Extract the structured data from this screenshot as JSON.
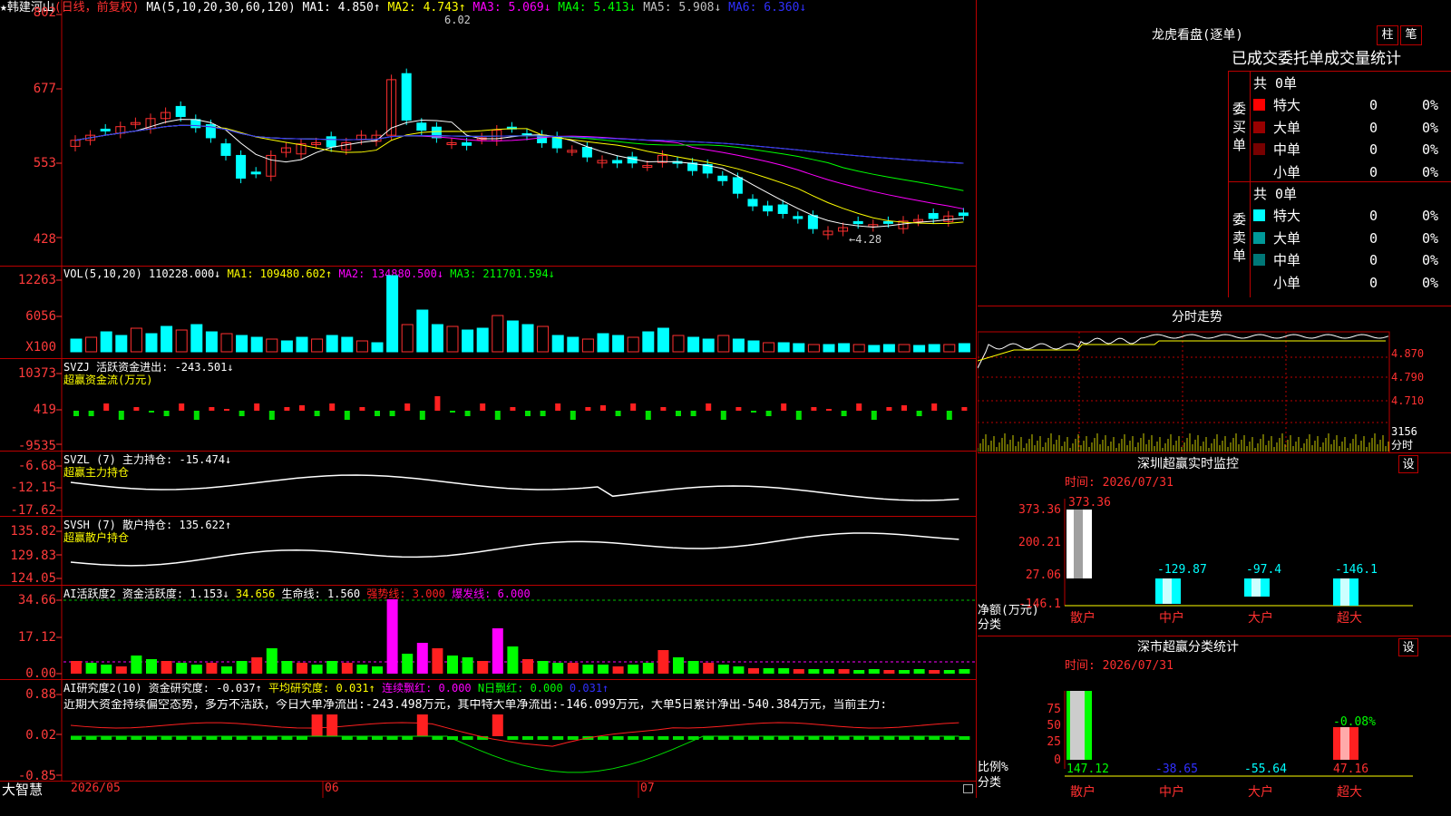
{
  "stock": {
    "name": "韩建河山",
    "mode": "(日线，前复权)"
  },
  "ma_header": {
    "params": "MA(5,10,20,30,60,120)",
    "items": [
      {
        "text": "MA1: 4.850↑",
        "color": "#ffffff"
      },
      {
        "text": "MA2: 4.743↑",
        "color": "#ffff00"
      },
      {
        "text": "MA3: 5.069↓",
        "color": "#ff00ff"
      },
      {
        "text": "MA4: 5.413↓",
        "color": "#00ff00"
      },
      {
        "text": "MA5: 5.908↓",
        "color": "#c0c0c0"
      },
      {
        "text": "MA6: 6.360↓",
        "color": "#3030ff"
      }
    ]
  },
  "price_axis": [
    "802",
    "677",
    "553",
    "428"
  ],
  "price_annotations": {
    "high": "6.02",
    "low": "←4.28"
  },
  "vol_header": {
    "params": "VOL(5,10,20)",
    "items": [
      {
        "text": "110228.000↓",
        "color": "#ffffff"
      },
      {
        "text": "MA1: 109480.602↑",
        "color": "#ffff00"
      },
      {
        "text": "MA2: 134880.500↓",
        "color": "#ff00ff"
      },
      {
        "text": "MA3: 211701.594↓",
        "color": "#00ff00"
      }
    ]
  },
  "vol_axis": [
    "12263",
    "6056",
    "X100"
  ],
  "svzj": {
    "header": "SVZJ  活跃资金进出: -243.501↓",
    "subtitle": "超赢资金流(万元)",
    "axis": [
      "10373",
      "419",
      "-9535"
    ]
  },
  "svzl": {
    "header": "SVZL (7) 主力持仓: -15.474↓",
    "subtitle": "超赢主力持仓",
    "axis": [
      "-6.68",
      "-12.15",
      "-17.62"
    ]
  },
  "svsh": {
    "header": "SVSH (7) 散户持仓: 135.622↑",
    "subtitle": "超赢散户持仓",
    "axis": [
      "135.82",
      "129.83",
      "124.05"
    ]
  },
  "ai_active": {
    "items": [
      {
        "text": "AI活跃度2 资金活跃度: 1.153↓",
        "color": "#ffffff"
      },
      {
        "text": "34.656",
        "color": "#ffff00"
      },
      {
        "text": "生命线: 1.560",
        "color": "#ffffff"
      },
      {
        "text": "强势线: 3.000",
        "color": "#ff2020"
      },
      {
        "text": "爆发线: 6.000",
        "color": "#ff00ff"
      }
    ],
    "axis": [
      "34.66",
      "17.12",
      "0.00"
    ]
  },
  "ai_research": {
    "items": [
      {
        "text": "AI研究度2(10) 资金研究度: -0.037↑",
        "color": "#ffffff"
      },
      {
        "text": "平均研究度: 0.031↑",
        "color": "#ffff00"
      },
      {
        "text": "连续飘红: 0.000",
        "color": "#ff00ff"
      },
      {
        "text": "N日飘红: 0.000",
        "color": "#00ff00"
      },
      {
        "text": "0.031↑",
        "color": "#3030ff"
      }
    ],
    "summary": "近期大资金持续偏空态势，多方不活跃，今日大单净流出:-243.498万元，其中特大单净流出:-146.099万元，大单5日累计净出-540.384万元，当前主力:",
    "axis": [
      "0.88",
      "0.02",
      "-0.85"
    ]
  },
  "footer": {
    "brand": "大智慧",
    "dates": [
      "2026/05",
      "06",
      "07"
    ]
  },
  "dragon_tiger": {
    "title": "龙虎看盘(逐单)",
    "btn_zhu": "柱",
    "btn_bi": "笔",
    "subtitle": "已成交委托单成交量统计",
    "buy": {
      "label": "委买单",
      "total": "共 0单",
      "rows": [
        {
          "name": "特大",
          "color": "#ff0000",
          "count": "0",
          "pct": "0%"
        },
        {
          "name": "大单",
          "color": "#990000",
          "count": "0",
          "pct": "0%"
        },
        {
          "name": "中单",
          "color": "#770000",
          "count": "0",
          "pct": "0%"
        },
        {
          "name": "小单",
          "color": "",
          "count": "0",
          "pct": "0%"
        }
      ]
    },
    "sell": {
      "label": "委卖单",
      "total": "共 0单",
      "rows": [
        {
          "name": "特大",
          "color": "#00ffff",
          "count": "0",
          "pct": "0%"
        },
        {
          "name": "大单",
          "color": "#009999",
          "count": "0",
          "pct": "0%"
        },
        {
          "name": "中单",
          "color": "#007777",
          "count": "0",
          "pct": "0%"
        },
        {
          "name": "小单",
          "color": "",
          "count": "0",
          "pct": "0%"
        }
      ]
    }
  },
  "intraday": {
    "title": "分时走势",
    "axis": [
      "4.870",
      "4.790",
      "4.710"
    ],
    "vol_label": "3156",
    "unit": "分时"
  },
  "sz_monitor": {
    "title": "深圳超赢实时监控",
    "btn": "设",
    "time": "时间: 2026/07/31",
    "axis": [
      "373.36",
      "200.21",
      "27.06",
      "-146.1"
    ],
    "ylabel": "净额(万元)",
    "xlabel": "分类",
    "categories": [
      "散户",
      "中户",
      "大户",
      "超大"
    ],
    "values": [
      "373.36",
      "-129.87",
      "-97.4",
      "-146.1"
    ]
  },
  "sz_class": {
    "title": "深市超赢分类统计",
    "btn": "设",
    "time": "时间: 2026/07/31",
    "axis": [
      "75",
      "50",
      "25",
      "0"
    ],
    "ylabel": "比例%",
    "xlabel": "分类",
    "categories": [
      "散户",
      "中户",
      "大户",
      "超大"
    ],
    "values": [
      "147.12",
      "-38.65",
      "-55.64",
      "47.16"
    ],
    "top_label": "-0.08%"
  }
}
